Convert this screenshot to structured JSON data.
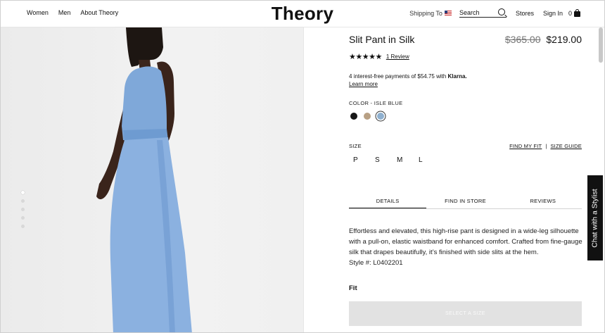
{
  "header": {
    "nav": [
      "Women",
      "Men",
      "About Theory"
    ],
    "logo": "Theory",
    "shipping_label": "Shipping To",
    "search_placeholder": "Search",
    "stores": "Stores",
    "sign_in": "Sign In",
    "bag_count": "0"
  },
  "product": {
    "title": "Slit Pant in Silk",
    "old_price": "$365.00",
    "price": "$219.00",
    "stars": "★★★★★",
    "review_link": "1 Review",
    "klarna_text": "4 interest-free payments of $54.75 with ",
    "klarna_brand": "Klarna.",
    "learn_more": "Learn more",
    "color_label": "COLOR - ISLE BLUE",
    "swatches": [
      {
        "name": "black",
        "hex": "#161616"
      },
      {
        "name": "tan",
        "hex": "#b8a084"
      },
      {
        "name": "isle blue",
        "hex": "#8fb0cf",
        "selected": true
      }
    ],
    "size_label": "SIZE",
    "find_my_fit": "FIND MY FIT",
    "size_sep": "|",
    "size_guide": "SIZE GUIDE",
    "sizes": [
      "P",
      "S",
      "M",
      "L"
    ],
    "tabs": [
      "DETAILS",
      "FIND IN STORE",
      "REVIEWS"
    ],
    "active_tab": "DETAILS",
    "description": "Effortless and elevated, this high-rise pant is designed in a wide-leg silhouette with a pull-on, elastic waistband for enhanced comfort. Crafted from fine-gauge silk that drapes beautifully, it’s finished with side slits at the hem.",
    "style_number": "Style #: L0402201",
    "fit_label": "Fit",
    "select_size_button": "SELECT A SIZE"
  },
  "gallery": {
    "dot_count": 5,
    "active_dot": 0
  },
  "chat": {
    "label": "Chat with a Stylist"
  }
}
